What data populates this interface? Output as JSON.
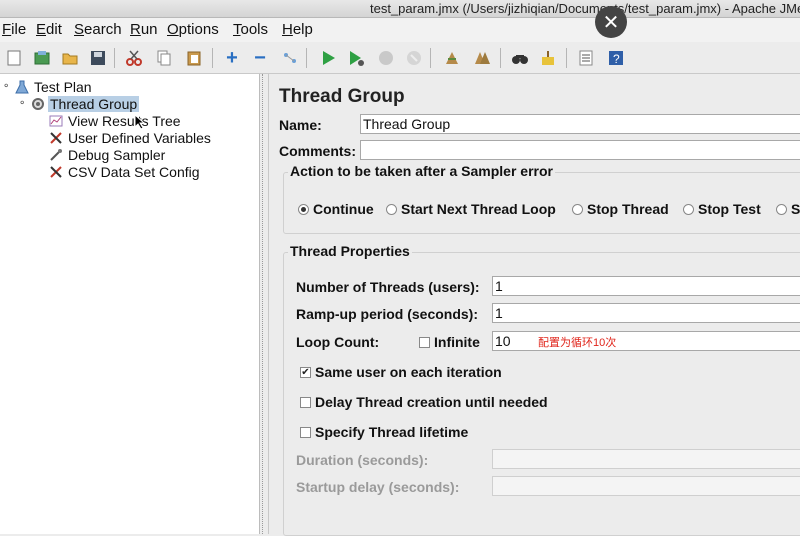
{
  "window": {
    "title": "test_param.jmx (/Users/jizhiqian/Documents/test_param.jmx) - Apache JMeter"
  },
  "menu": [
    "File",
    "Edit",
    "Search",
    "Run",
    "Options",
    "Tools",
    "Help"
  ],
  "toolbar": {
    "icons": [
      "new-icon",
      "templates-icon",
      "open-icon",
      "save-icon",
      "cut-icon",
      "copy-icon",
      "paste-icon",
      "expand-icon",
      "collapse-icon",
      "toggle-icon",
      "start-icon",
      "start-no-pauses-icon",
      "stop-icon",
      "shutdown-icon",
      "clear-icon",
      "clear-all-icon",
      "search-icon",
      "reset-search-icon",
      "function-helper-icon",
      "help-icon"
    ]
  },
  "tree": {
    "root": "Test Plan",
    "group": "Thread Group",
    "children": [
      "View Results Tree",
      "User Defined Variables",
      "Debug Sampler",
      "CSV Data Set Config"
    ]
  },
  "panel": {
    "title": "Thread Group",
    "name_label": "Name:",
    "name_value": "Thread Group",
    "comments_label": "Comments:",
    "comments_value": "",
    "error_action": {
      "title": "Action to be taken after a Sampler error",
      "options": [
        "Continue",
        "Start Next Thread Loop",
        "Stop Thread",
        "Stop Test",
        "St"
      ],
      "selected": "Continue"
    },
    "thread_props": {
      "title": "Thread Properties",
      "threads_label": "Number of Threads (users):",
      "threads_value": "1",
      "rampup_label": "Ramp-up period (seconds):",
      "rampup_value": "1",
      "loop_label": "Loop Count:",
      "infinite_label": "Infinite",
      "infinite_checked": false,
      "loop_value": "10",
      "loop_note": "配置为循环10次",
      "same_user_label": "Same user on each iteration",
      "same_user_checked": true,
      "delay_label": "Delay Thread creation until needed",
      "delay_checked": false,
      "lifetime_label": "Specify Thread lifetime",
      "lifetime_checked": false,
      "duration_label": "Duration (seconds):",
      "duration_value": "",
      "startup_label": "Startup delay (seconds):",
      "startup_value": ""
    }
  },
  "colors": {
    "selection": "#b8cfe5",
    "note": "#e0251b",
    "background": "#ececec"
  }
}
